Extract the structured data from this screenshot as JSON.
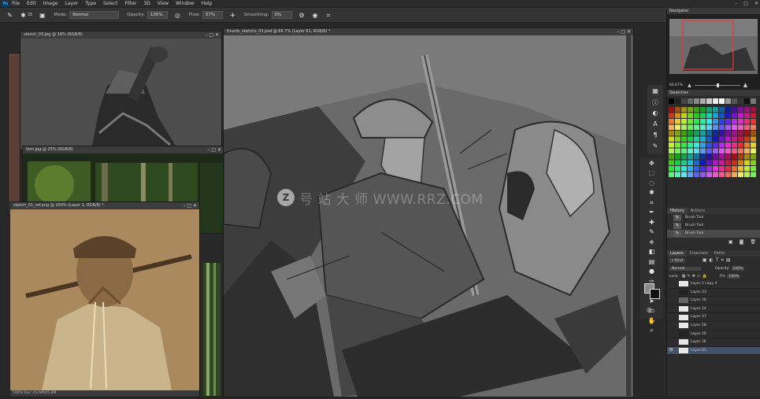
{
  "menu": {
    "logo": "Ps",
    "items": [
      "File",
      "Edit",
      "Image",
      "Layer",
      "Type",
      "Select",
      "Filter",
      "3D",
      "View",
      "Window",
      "Help"
    ],
    "window_controls": [
      "–",
      "□",
      "✕"
    ]
  },
  "options_bar": {
    "brush_size": "25",
    "mode_label": "Mode:",
    "mode_value": "Normal",
    "opacity_label": "Opacity:",
    "opacity_value": "100%",
    "flow_label": "Flow:",
    "flow_value": "57%",
    "smoothing_label": "Smoothing:",
    "smoothing_value": "0%"
  },
  "documents": {
    "sketch": {
      "tab": "sketch_03.jpg @ 16% (RGB/8)",
      "controls": "– □ ✕"
    },
    "forest": {
      "tab": "fern.jpg @ 25% (RGB/8)",
      "controls": "– □ ✕"
    },
    "photo": {
      "tab": "sketch_01_ref.png @ 100% (Layer 1, RGB/8) *",
      "controls": "– □ ✕",
      "status": "100%      Doc: 43.6M/45.0M"
    },
    "main": {
      "tab": "thumb_sketchs_03.psd @ 66.7% (Layer 61, RGB/8) *",
      "controls": "– □ ✕"
    }
  },
  "watermark": {
    "text": "号 站 大 师  WWW.RRZ.COM",
    "logo": "Z"
  },
  "navigator": {
    "title": "Navigator",
    "zoom": "66.67%"
  },
  "swatches": {
    "title": "Swatches"
  },
  "history": {
    "tabs": [
      "History",
      "Actions"
    ],
    "items": [
      {
        "label": "Brush Tool",
        "selected": false
      },
      {
        "label": "Brush Tool",
        "selected": false
      },
      {
        "label": "Brush Tool",
        "selected": true
      }
    ]
  },
  "layers": {
    "tabs": [
      "Layers",
      "Channels",
      "Paths"
    ],
    "kind_label": "Kind",
    "blend_mode": "Normal",
    "opacity_label": "Opacity:",
    "opacity_value": "100%",
    "lock_label": "Lock:",
    "fill_label": "Fill:",
    "fill_value": "100%",
    "items": [
      {
        "name": "Layer 1 copy 4",
        "eye": ""
      },
      {
        "name": "Layer 23",
        "eye": ""
      },
      {
        "name": "Layer 30",
        "eye": ""
      },
      {
        "name": "Layer 24",
        "eye": ""
      },
      {
        "name": "Layer 27",
        "eye": ""
      },
      {
        "name": "Layer 28",
        "eye": ""
      },
      {
        "name": "Layer 29",
        "eye": ""
      },
      {
        "name": "Layer 36",
        "eye": ""
      },
      {
        "name": "Layer 61",
        "eye": "👁"
      }
    ]
  }
}
